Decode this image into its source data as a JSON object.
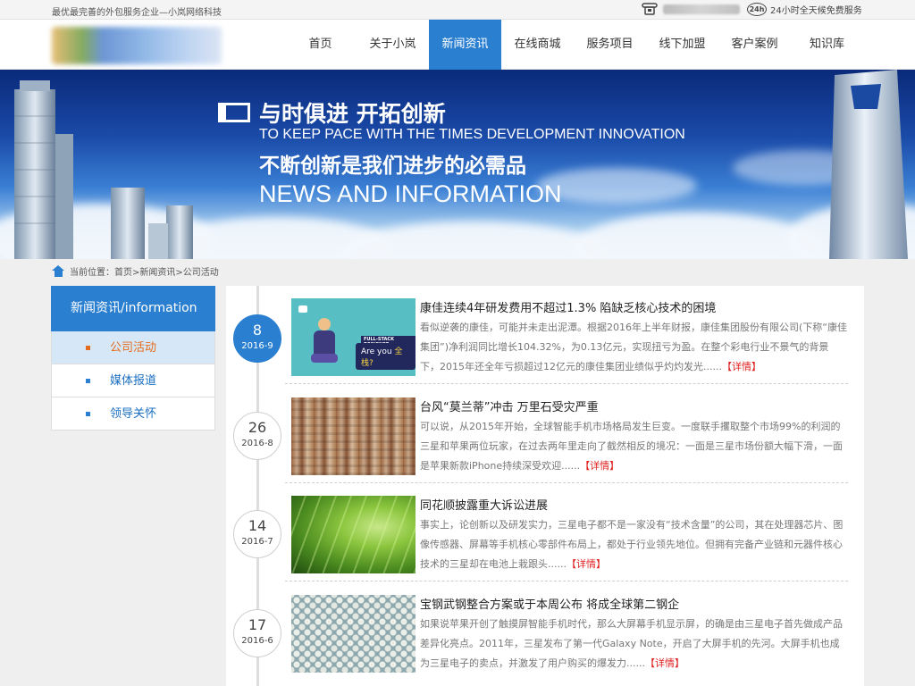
{
  "topbar": {
    "slogan": "最优最完善的外包服务企业—小岚网络科技",
    "service_badge": "24h",
    "service": "24小时全天候免费服务"
  },
  "nav": {
    "items": [
      {
        "label": "首页"
      },
      {
        "label": "关于小岚"
      },
      {
        "label": "新闻资讯"
      },
      {
        "label": "在线商城"
      },
      {
        "label": "服务项目"
      },
      {
        "label": "线下加盟"
      },
      {
        "label": "客户案例"
      },
      {
        "label": "知识库"
      }
    ],
    "active": "新闻资讯"
  },
  "banner": {
    "line1": "与时俱进 开拓创新",
    "line2": "TO KEEP PACE WITH THE TIMES DEVELOPMENT INNOVATION",
    "line3": "不断创新是我们进步的必需品",
    "line4": "NEWS AND INFORMATION"
  },
  "breadcrumb": {
    "text": "当前位置：首页>新闻资讯>公司活动"
  },
  "sidebar": {
    "title": "新闻资讯/information",
    "items": [
      {
        "label": "公司活动"
      },
      {
        "label": "媒体报道"
      },
      {
        "label": "领导关怀"
      }
    ],
    "active": "公司活动"
  },
  "thumb1": {
    "label1": "FULL-STACK DESIGNER",
    "label2_prefix": "Are you ",
    "label2_highlight": "全栈?"
  },
  "news": [
    {
      "day": "8",
      "ym": "2016-9",
      "title": "康佳连续4年研发费用不超过1.3% 陷缺乏核心技术的困境",
      "desc": "看似逆袭的康佳，可能并未走出泥潭。根据2016年上半年财报，康佳集团股份有限公司(下称“康佳集团”)净利润同比增长104.32%，为0.13亿元，实现扭亏为盈。在整个彩电行业不景气的背景下，2015年还全年亏损超过12亿元的康佳集团业绩似乎灼灼发光......",
      "more": "【详情】"
    },
    {
      "day": "26",
      "ym": "2016-8",
      "title": "台风“莫兰蒂”冲击 万里石受灾严重",
      "desc": "可以说，从2015年开始，全球智能手机市场格局发生巨变。一度联手攫取整个市场99%的利润的三星和苹果两位玩家，在过去两年里走向了截然相反的境况：一面是三星市场份额大幅下滑，一面是苹果新款iPhone持续深受欢迎......",
      "more": "【详情】"
    },
    {
      "day": "14",
      "ym": "2016-7",
      "title": "同花顺披露重大诉讼进展",
      "desc": "事实上，论创新以及研发实力，三星电子都不是一家没有“技术含量”的公司，其在处理器芯片、图像传感器、屏幕等手机核心零部件布局上，都处于行业领先地位。但拥有完备产业链和元器件核心技术的三星却在电池上栽跟头......",
      "more": "【详情】"
    },
    {
      "day": "17",
      "ym": "2016-6",
      "title": "宝钢武钢整合方案或于本周公布 将成全球第二钢企",
      "desc": "如果说苹果开创了触摸屏智能手机时代，那么大屏幕手机显示屏，的确是由三星电子首先做成产品差异化亮点。2011年，三星发布了第一代Galaxy Note，开启了大屏手机的先河。大屏手机也成为三星电子的卖点，并激发了用户购买的爆发力......",
      "more": "【详情】"
    }
  ]
}
